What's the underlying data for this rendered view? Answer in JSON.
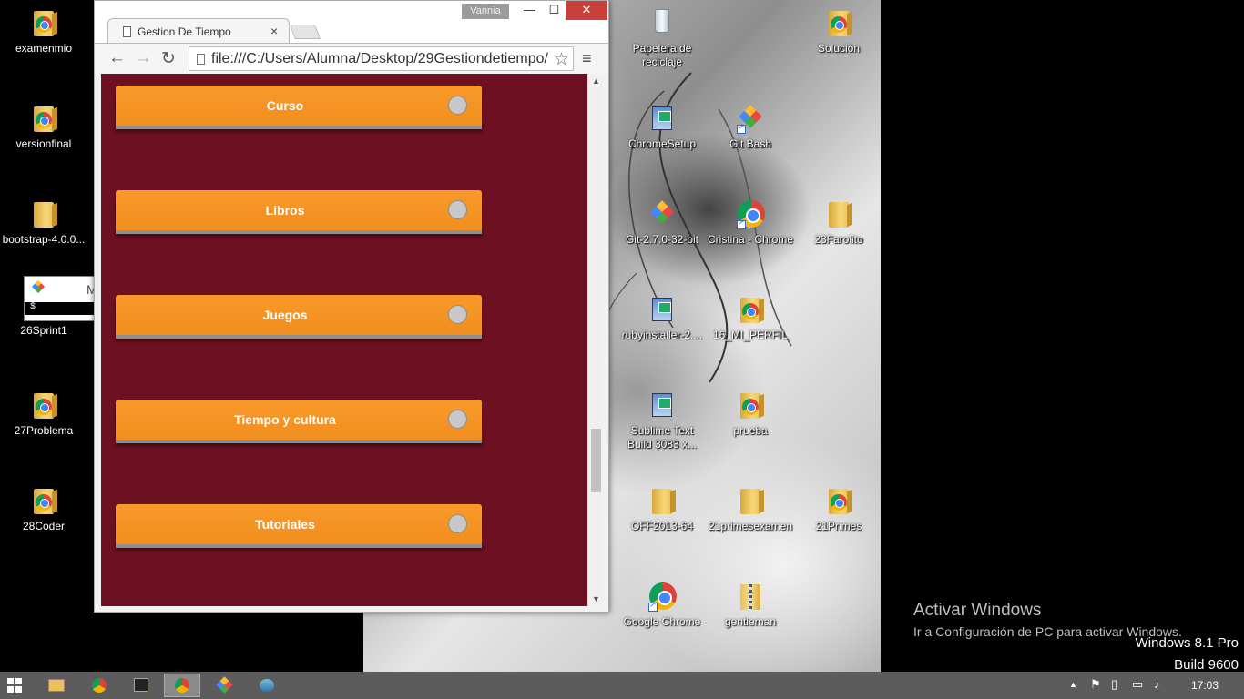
{
  "browser": {
    "user": "Vannia",
    "tab_title": "Gestion De Tiempo",
    "tab_close": "×",
    "url": "file:///C:/Users/Alumna/Desktop/29Gestiondetiempo/",
    "window_buttons": {
      "minimize": "—",
      "maximize": "☐",
      "close": "✕"
    },
    "nav": {
      "back": "←",
      "forward": "→",
      "reload": "↻",
      "bookmark": "☆",
      "menu": "≡"
    }
  },
  "page": {
    "cards": [
      {
        "label": "Curso"
      },
      {
        "label": "Libros"
      },
      {
        "label": "Juegos"
      },
      {
        "label": "Tiempo y cultura"
      },
      {
        "label": "Tutoriales"
      }
    ],
    "colors": {
      "background": "#6d1021",
      "card": "#f7941d"
    }
  },
  "desktop": {
    "left_icons": [
      {
        "label": "examenmio",
        "icon": "chrome-folder-icon"
      },
      {
        "label": "versionfinal",
        "icon": "chrome-folder-icon"
      },
      {
        "label": "bootstrap-4.0.0...",
        "icon": "folder-icon"
      },
      {
        "label": "26Sprint1",
        "icon": "git-bash-window-preview"
      },
      {
        "label": "27Problema",
        "icon": "chrome-folder-icon"
      },
      {
        "label": "28Coder",
        "icon": "chrome-folder-icon"
      }
    ],
    "terminal_prompt": "$",
    "terminal_title_letter": "M",
    "icons": [
      {
        "label": "Papelera de reciclaje",
        "icon": "recycle-bin-icon"
      },
      {
        "label": "Solución",
        "icon": "chrome-folder-icon"
      },
      {
        "label": "ChromeSetup",
        "icon": "setup-icon"
      },
      {
        "label": "Git Bash",
        "icon": "git-icon"
      },
      {
        "label": "Git-2.7.0-32-bit",
        "icon": "git-icon"
      },
      {
        "label": "Cristina - Chrome",
        "icon": "chrome-icon"
      },
      {
        "label": "23Farolito",
        "icon": "folder-icon"
      },
      {
        "label": "rubyinstaller-2....",
        "icon": "setup-icon"
      },
      {
        "label": "16_MI_PERFIL",
        "icon": "chrome-folder-icon"
      },
      {
        "label": "Sublime Text Build 3083 x...",
        "icon": "setup-icon"
      },
      {
        "label": "prueba",
        "icon": "chrome-folder-icon"
      },
      {
        "label": "OFF2013-64",
        "icon": "folder-icon"
      },
      {
        "label": "21primesexamen",
        "icon": "folder-icon"
      },
      {
        "label": "21Primes",
        "icon": "chrome-folder-icon"
      },
      {
        "label": "Google Chrome",
        "icon": "chrome-icon"
      },
      {
        "label": "gentleman",
        "icon": "zip-folder-icon"
      }
    ]
  },
  "watermark": {
    "title": "Activar Windows",
    "subtitle": "Ir a Configuración de PC para activar Windows.",
    "os_line1": "Windows 8.1 Pro",
    "os_line2": "Build 9600"
  },
  "taskbar": {
    "apps": [
      "start-icon",
      "file-explorer-icon",
      "chrome-icon",
      "terminal-icon",
      "chrome-active-icon",
      "git-icon",
      "control-panel-icon"
    ],
    "clock": "17:03"
  }
}
